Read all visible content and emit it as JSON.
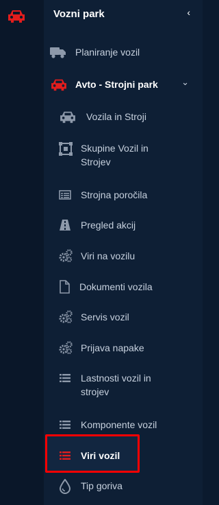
{
  "section": {
    "title": "Vozni park",
    "collapse_glyph": "‹"
  },
  "menu": {
    "planiranje": {
      "label": "Planiranje vozil",
      "icon": "truck-icon"
    },
    "avto": {
      "label": "Avto - Strojni park",
      "icon": "car-icon",
      "chevron": "⌄"
    },
    "items": [
      {
        "label": "Vozila in Stroji",
        "icon": "car-icon"
      },
      {
        "label": "Skupine Vozil in Strojev",
        "icon": "group-icon"
      },
      {
        "label": "Strojna poročila",
        "icon": "report-icon"
      },
      {
        "label": "Pregled akcij",
        "icon": "road-icon"
      },
      {
        "label": "Viri na vozilu",
        "icon": "cogs-icon"
      },
      {
        "label": "Dokumenti vozila",
        "icon": "document-icon"
      },
      {
        "label": "Servis vozil",
        "icon": "cogs-icon"
      },
      {
        "label": "Prijava napake",
        "icon": "cogs-icon"
      },
      {
        "label": "Lastnosti vozil in strojev",
        "icon": "list-icon"
      },
      {
        "label": "Komponente vozil",
        "icon": "list-icon"
      },
      {
        "label": "Viri vozil",
        "icon": "list-icon",
        "active": true
      },
      {
        "label": "Tip goriva",
        "icon": "drop-icon"
      }
    ]
  },
  "colors": {
    "accent": "#e21d1d",
    "highlight_border": "#ff0000",
    "background": "#0e1f35"
  }
}
